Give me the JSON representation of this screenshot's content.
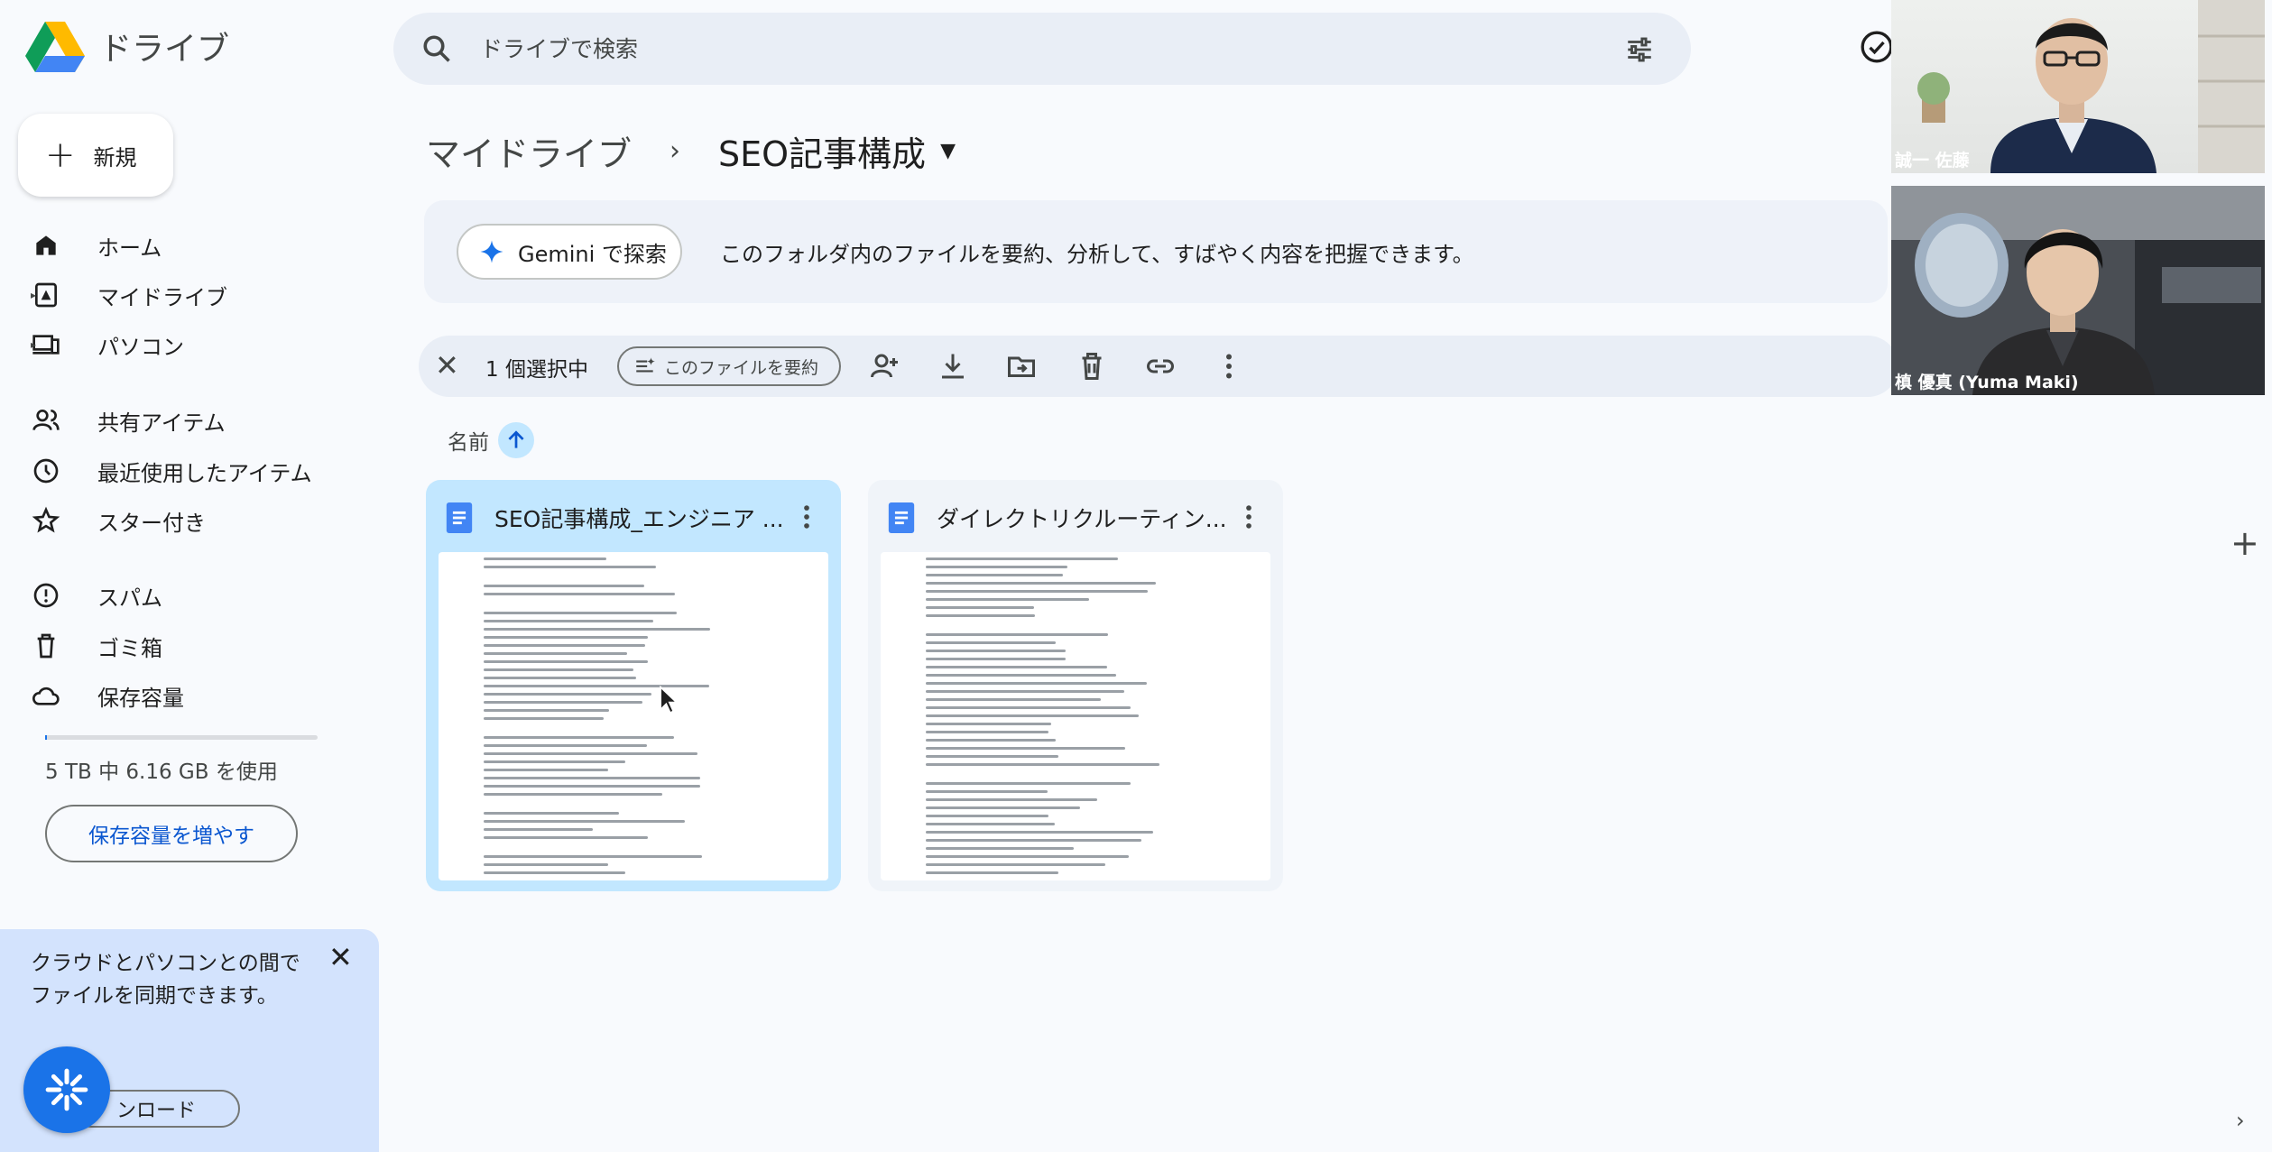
{
  "app": {
    "title": "ドライブ"
  },
  "sidebar": {
    "new_label": "新規",
    "items": [
      {
        "label": "ホーム",
        "icon": "home-icon"
      },
      {
        "label": "マイドライブ",
        "icon": "my-drive-icon"
      },
      {
        "label": "パソコン",
        "icon": "computers-icon"
      },
      {
        "label": "共有アイテム",
        "icon": "shared-icon"
      },
      {
        "label": "最近使用したアイテム",
        "icon": "recent-icon"
      },
      {
        "label": "スター付き",
        "icon": "star-icon"
      },
      {
        "label": "スパム",
        "icon": "spam-icon"
      },
      {
        "label": "ゴミ箱",
        "icon": "trash-icon"
      },
      {
        "label": "保存容量",
        "icon": "cloud-icon"
      }
    ],
    "storage_used": "5 TB 中 6.16 GB を使用",
    "storage_fraction": 0.0012,
    "storage_button": "保存容量を増やす",
    "sync_card": {
      "text": "クラウドとパソコンとの間でファイルを同期できます。",
      "download_label": "ンロード"
    }
  },
  "search": {
    "placeholder": "ドライブで検索"
  },
  "breadcrumb": {
    "root": "マイドライブ",
    "current": "SEO記事構成"
  },
  "gemini": {
    "button_label": "Gemini で探索",
    "description": "このフォルダ内のファイルを要約、分析して、すばやく内容を把握できます。"
  },
  "selection_bar": {
    "count_label": "1 個選択中",
    "summarize_label": "このファイルを要約"
  },
  "sort": {
    "label": "名前"
  },
  "files": [
    {
      "name": "SEO記事構成_エンジニア ...",
      "selected": true
    },
    {
      "name": "ダイレクトリクルーティン...",
      "selected": false
    }
  ],
  "video": {
    "participants": [
      {
        "name": "誠一 佐藤"
      },
      {
        "name": "槙 優真 (Yuma Maki)"
      }
    ]
  },
  "colors": {
    "accent": "#0b57d0",
    "selected": "#c2e7ff",
    "background": "#f8fafd"
  }
}
